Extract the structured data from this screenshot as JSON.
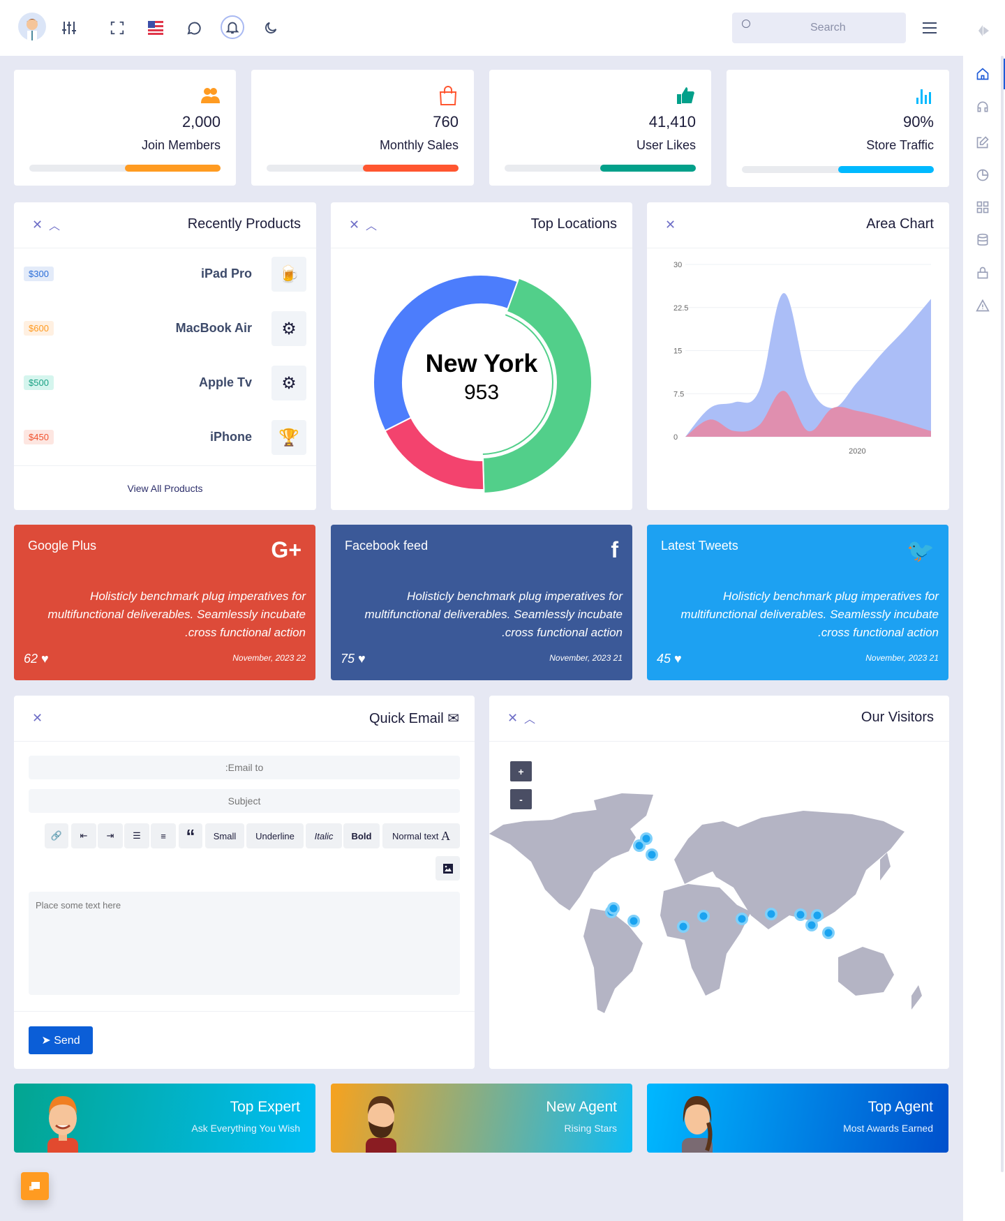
{
  "topbar": {
    "search_placeholder": "Search",
    "icons": [
      "avatar",
      "sliders-icon",
      "fullscreen-icon",
      "us-flag-icon",
      "chat-icon",
      "bell-icon",
      "moon-icon",
      "menu-icon"
    ]
  },
  "sidebar": {
    "icons": [
      "logo-icon",
      "home-icon",
      "headphones-icon",
      "edit-icon",
      "pie-chart-icon",
      "grid-icon",
      "database-icon",
      "lock-icon",
      "warning-icon"
    ],
    "active": "home-icon"
  },
  "stats": [
    {
      "value": "2,000",
      "label": "Join Members",
      "progress": 50,
      "color": "#ff9b21",
      "icon": "users-icon"
    },
    {
      "value": "760",
      "label": "Monthly Sales",
      "progress": 50,
      "color": "#ff5630",
      "icon": "shopping-bag-icon"
    },
    {
      "value": "41,410",
      "label": "User Likes",
      "progress": 50,
      "color": "#02a08a",
      "icon": "thumbs-up-icon"
    },
    {
      "value": "90%",
      "label": "Store Traffic",
      "progress": 50,
      "color": "#00b9ff",
      "icon": "bar-chart-icon"
    }
  ],
  "products": {
    "title": "Recently Products",
    "footer": "View All Products",
    "items": [
      {
        "price": "$300",
        "name": "iPad Pro",
        "color": "#2a6dd8",
        "bg": "#e3ebf9",
        "icon": "beer-icon"
      },
      {
        "price": "$600",
        "name": "MacBook Air",
        "color": "#ff9b21",
        "bg": "#fff0e1",
        "icon": "gear-wrench-icon"
      },
      {
        "price": "$500",
        "name": "Apple Tv",
        "color": "#1aa183",
        "bg": "#d5f5ee",
        "icon": "gear-check-icon"
      },
      {
        "price": "$450",
        "name": "iPhone",
        "color": "#f0532f",
        "bg": "#fde6e1",
        "icon": "trophy-icon"
      }
    ]
  },
  "locations": {
    "title": "Top Locations",
    "center_label": "New York",
    "center_value": "953"
  },
  "area": {
    "title": "Area Chart"
  },
  "chart_data": [
    {
      "type": "pie",
      "donut": true,
      "values": [
        44,
        18,
        38
      ],
      "colors": [
        "#52cf8a",
        "#f3436e",
        "#4c7dfc"
      ],
      "highlighted": 0
    },
    {
      "type": "area",
      "ylim": [
        0,
        30
      ],
      "y_ticks": [
        "0",
        "7.5",
        "15",
        "22.5",
        "30"
      ],
      "x_tick_labels": {
        "7": "2020"
      },
      "grid": true,
      "series": [
        {
          "color": "#a6bbf7",
          "values": [
            0,
            5,
            6,
            8,
            25,
            9.5,
            5,
            9.5,
            14.5,
            19,
            24
          ]
        },
        {
          "color": "#e38cab",
          "values": [
            0,
            3,
            1,
            2,
            8,
            1,
            5,
            4.5,
            3.5,
            2.3,
            1
          ]
        }
      ]
    }
  ],
  "social": [
    {
      "title": "Google Plus",
      "icon": "google-plus-icon",
      "glyph": "G+",
      "text": "Holisticly benchmark plug imperatives for multifunctional deliverables. Seamlessly incubate .cross functional action",
      "likes": "62",
      "date": "November, 2023 22",
      "color": "#dd4b39"
    },
    {
      "title": "Facebook feed",
      "icon": "facebook-icon",
      "glyph": "f",
      "text": "Holisticly benchmark plug imperatives for multifunctional deliverables. Seamlessly incubate .cross functional action",
      "likes": "75",
      "date": "November, 2023 21",
      "color": "#3b5998"
    },
    {
      "title": "Latest Tweets",
      "icon": "twitter-icon",
      "glyph": "🐦",
      "text": "Holisticly benchmark plug imperatives for multifunctional deliverables. Seamlessly incubate .cross functional action",
      "likes": "45",
      "date": "November, 2023 21",
      "color": "#1da1f2"
    }
  ],
  "email": {
    "title": "Quick Email",
    "to_placeholder": ":Email to",
    "subject_placeholder": "Subject",
    "body_placeholder": "Place some text here",
    "send": "Send",
    "toolbar": {
      "small": "Small",
      "underline": "Underline",
      "italic": "Italic",
      "bold": "Bold",
      "normal": "Normal text"
    }
  },
  "visitors": {
    "title": "Our Visitors",
    "zoom_in": "+",
    "zoom_out": "-"
  },
  "agents": [
    {
      "title": "Top Expert",
      "subtitle": "Ask Everything You Wish"
    },
    {
      "title": "New Agent",
      "subtitle": "Rising Stars"
    },
    {
      "title": "Top Agent",
      "subtitle": "Most Awards Earned"
    }
  ]
}
